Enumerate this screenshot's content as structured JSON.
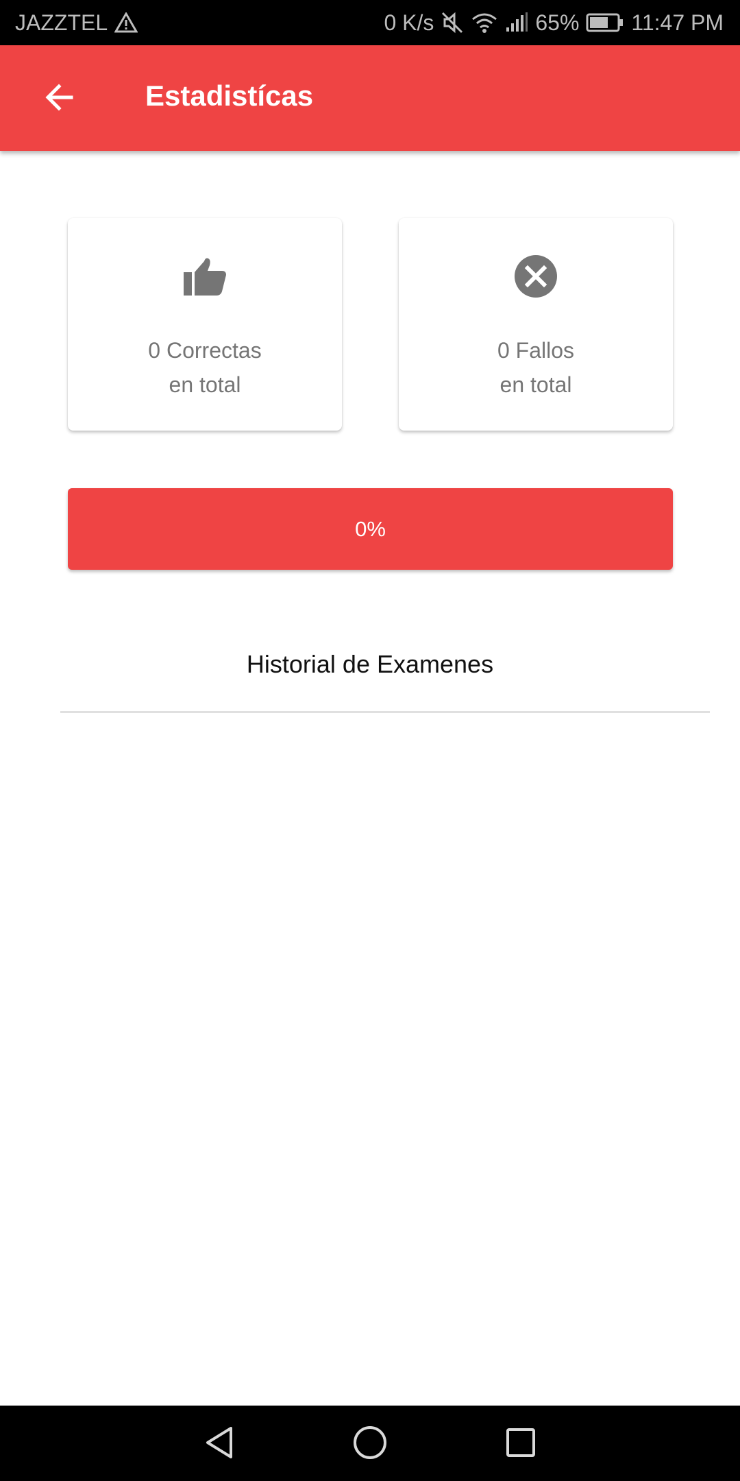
{
  "status_bar": {
    "carrier": "JAZZTEL",
    "speed": "0 K/s",
    "battery": "65%",
    "time": "11:47 PM",
    "icons": [
      "warning-icon",
      "mute-icon",
      "wifi-icon",
      "signal-icon",
      "battery-icon"
    ]
  },
  "app_bar": {
    "title": "Estadistícas",
    "back_icon": "arrow-back-icon"
  },
  "stats": {
    "correct": {
      "line1": "0 Correctas",
      "line2": "en total",
      "icon": "thumbs-up-icon"
    },
    "wrong": {
      "line1": "0 Fallos",
      "line2": "en total",
      "icon": "close-circle-icon"
    }
  },
  "progress": {
    "label": "0%",
    "value": 0
  },
  "history": {
    "title": "Historial de Examenes"
  },
  "nav_bar": {
    "icons": [
      "back-triangle-icon",
      "home-circle-icon",
      "recents-square-icon"
    ]
  },
  "colors": {
    "accent": "#ef4444",
    "icon_gray": "#757575",
    "status_bar": "#000000"
  }
}
